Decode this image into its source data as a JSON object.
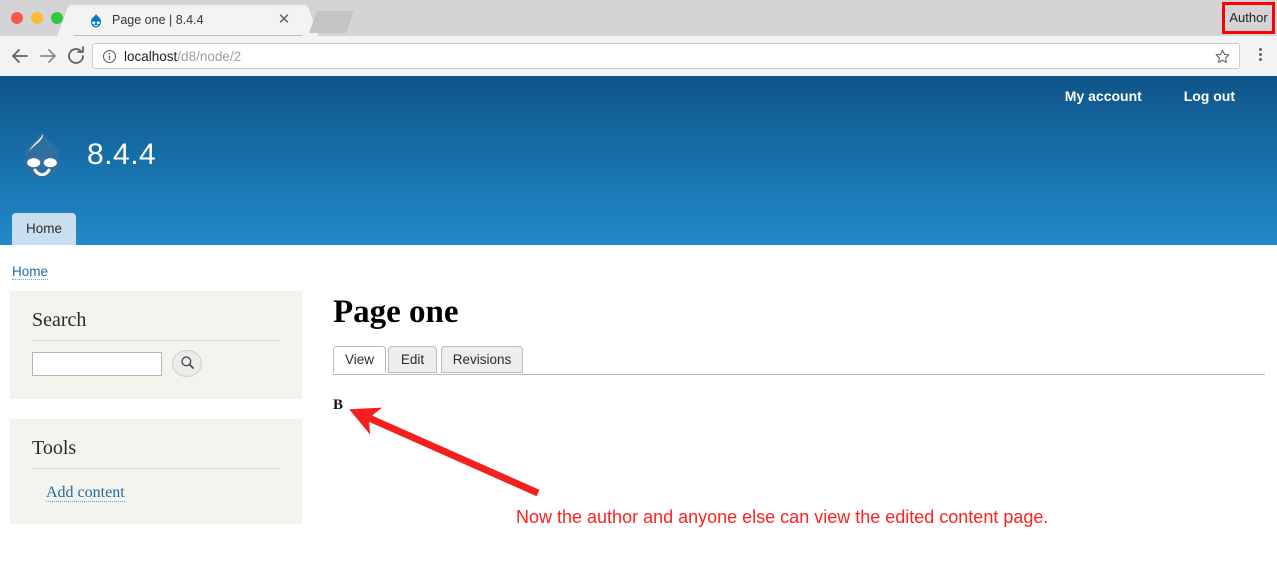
{
  "browser": {
    "tab": {
      "title": "Page one | 8.4.4",
      "favicon_icon": "drupal-droplet-icon",
      "close_icon": "close-icon"
    },
    "new_tab_icon": "new-tab-icon",
    "nav": {
      "back_icon": "back-arrow-icon",
      "forward_icon": "forward-arrow-icon",
      "reload_icon": "reload-icon"
    },
    "omnibox": {
      "page_info_icon": "info-circle-icon",
      "url_host": "localhost",
      "url_path": "/d8/node/2",
      "bookmark_icon": "star-icon"
    },
    "menu_icon": "three-dot-menu-icon",
    "author_badge": {
      "label": "Author",
      "highlight_color": "#ff0000"
    }
  },
  "site": {
    "header": {
      "logo_icon": "drupal-droplet-icon",
      "name": "8.4.4",
      "user_links": [
        {
          "label": "My account"
        },
        {
          "label": "Log out"
        }
      ],
      "menu": [
        {
          "label": "Home"
        }
      ],
      "gradient_top": "#0f5489",
      "gradient_bottom": "#2389c9"
    },
    "breadcrumb": [
      {
        "label": "Home"
      }
    ],
    "sidebar": {
      "blocks": [
        {
          "title": "Search",
          "search": {
            "value": "",
            "placeholder": "",
            "submit_icon": "magnifier-icon"
          }
        },
        {
          "title": "Tools",
          "links": [
            {
              "label": "Add content"
            }
          ]
        }
      ]
    },
    "main": {
      "title": "Page one",
      "tabs": [
        {
          "label": "View",
          "active": true
        },
        {
          "label": "Edit",
          "active": false
        },
        {
          "label": "Revisions",
          "active": false
        }
      ],
      "body": "B"
    }
  },
  "annotation": {
    "text": "Now the author and anyone else can view the edited content page.",
    "color": "#ff2020",
    "arrow_icon": "red-arrow-icon"
  }
}
